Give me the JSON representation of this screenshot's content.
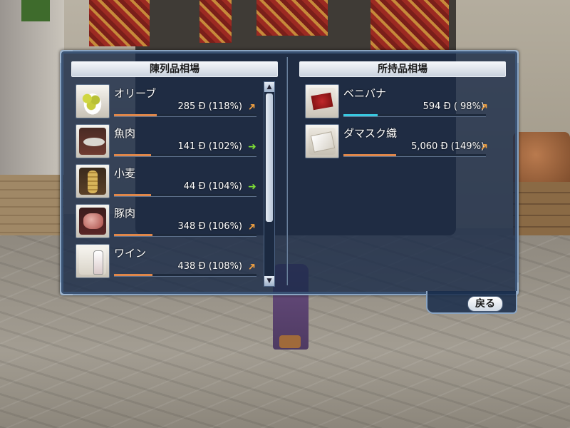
{
  "left_panel": {
    "title": "陳列品相場",
    "items": [
      {
        "name": "オリーブ",
        "price": "285",
        "currency": "Ð",
        "percent": "(118%)",
        "trend": "up",
        "bar_level": 0.3
      },
      {
        "name": "魚肉",
        "price": "141",
        "currency": "Ð",
        "percent": "(102%)",
        "trend": "flat",
        "bar_level": 0.26
      },
      {
        "name": "小麦",
        "price": "44",
        "currency": "Ð",
        "percent": "(104%)",
        "trend": "flat",
        "bar_level": 0.26
      },
      {
        "name": "豚肉",
        "price": "348",
        "currency": "Ð",
        "percent": "(106%)",
        "trend": "up",
        "bar_level": 0.27
      },
      {
        "name": "ワイン",
        "price": "438",
        "currency": "Ð",
        "percent": "(108%)",
        "trend": "up",
        "bar_level": 0.27
      }
    ]
  },
  "right_panel": {
    "title": "所持品相場",
    "items": [
      {
        "name": "ベニバナ",
        "price": "594",
        "currency": "Ð",
        "percent": "( 98%)",
        "trend": "up",
        "bar_level": 0.24
      },
      {
        "name": "ダマスク織",
        "price": "5,060",
        "currency": "Ð",
        "percent": "(149%)",
        "trend": "up",
        "bar_level": 0.37
      }
    ]
  },
  "back_button": {
    "label": "戻る"
  },
  "colors": {
    "bar_normal": "#e0874a",
    "bar_cyan": "#38c8e0",
    "trend_up": "#f0a040",
    "trend_flat": "#7ee036"
  },
  "icons": {
    "trend_up": "diagonal-arrow-up-icon",
    "trend_flat": "right-arrow-icon"
  }
}
